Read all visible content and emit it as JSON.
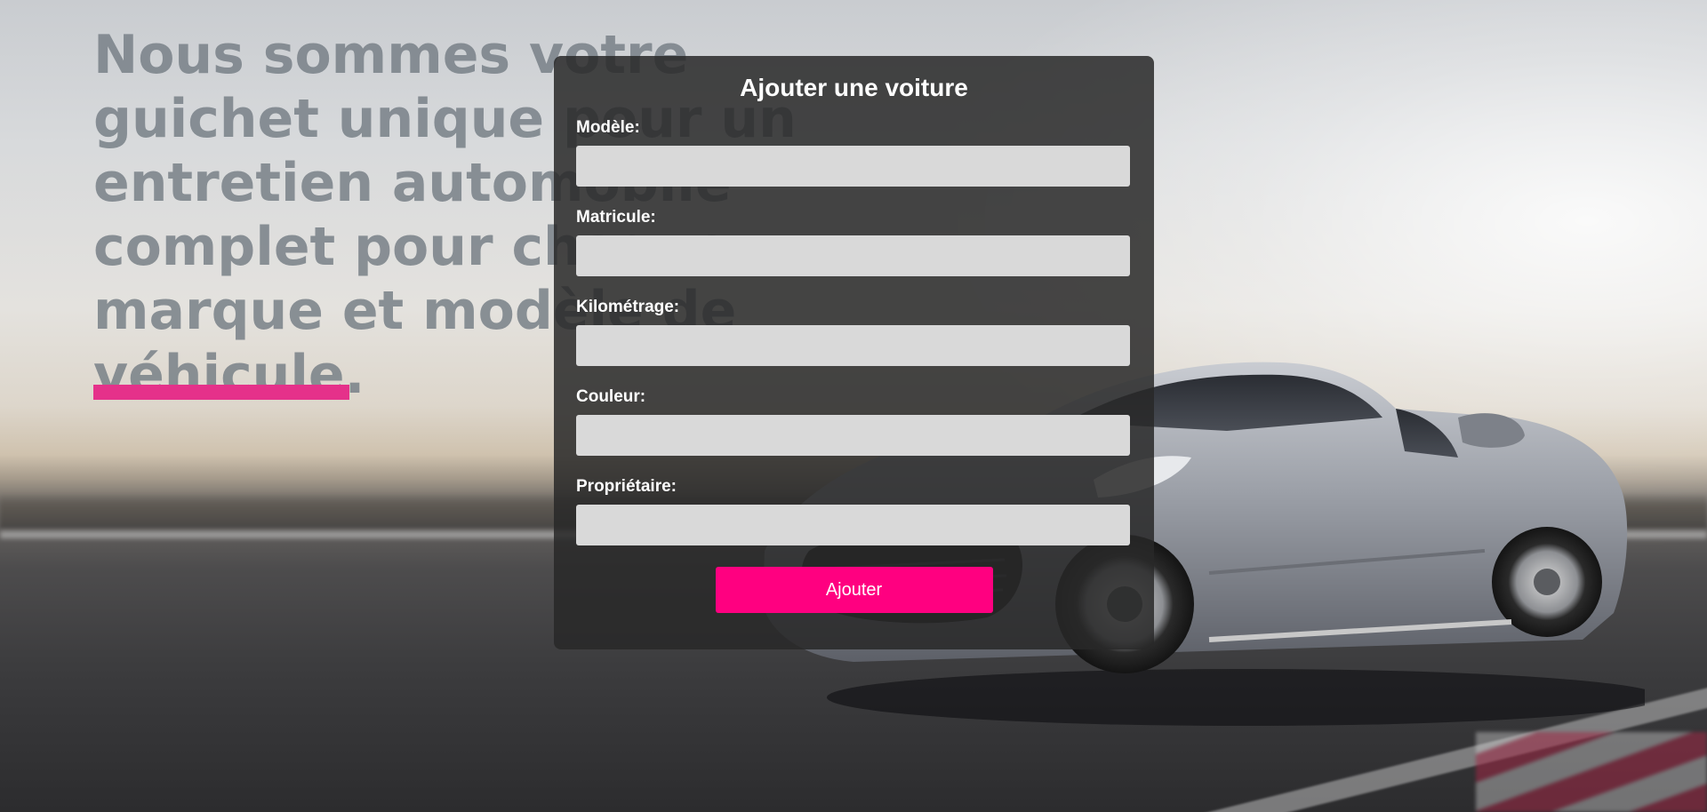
{
  "hero": {
    "headline": "Nous sommes votre guichet unique pour un entretien automobile complet pour chaque marque et modèle de véhicule."
  },
  "form": {
    "title": "Ajouter une voiture",
    "fields": [
      {
        "label": "Modèle:",
        "value": "",
        "placeholder": ""
      },
      {
        "label": "Matricule:",
        "value": "",
        "placeholder": ""
      },
      {
        "label": "Kilométrage:",
        "value": "",
        "placeholder": ""
      },
      {
        "label": "Couleur:",
        "value": "",
        "placeholder": ""
      },
      {
        "label": "Propriétaire:",
        "value": "",
        "placeholder": ""
      }
    ],
    "submit_label": "Ajouter"
  },
  "colors": {
    "accent": "#ff0080",
    "accent_bar": "#e5318a",
    "panel": "#282828",
    "input_bg": "#d9d9d9"
  },
  "icons": {
    "background_image": "sports-car-photo"
  }
}
